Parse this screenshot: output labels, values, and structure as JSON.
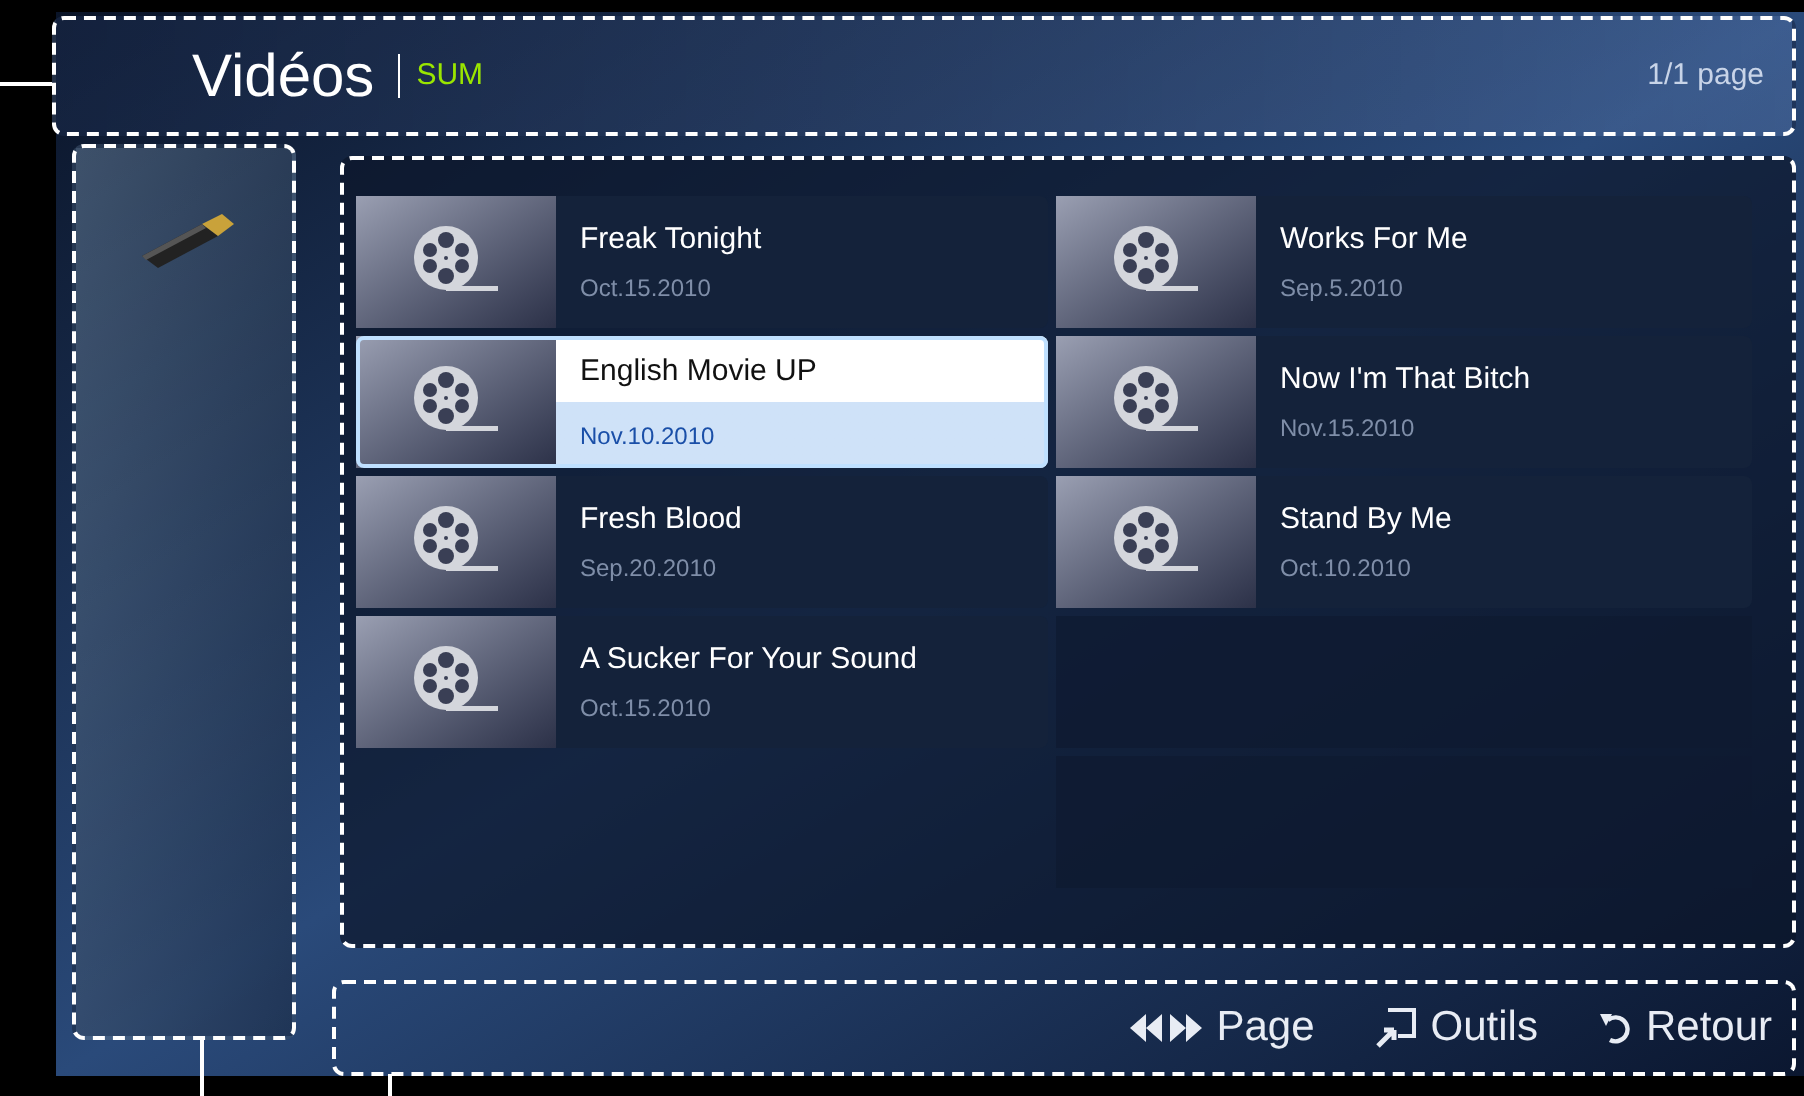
{
  "header": {
    "title": "Vidéos",
    "source": "SUM",
    "page_count": "1/1 page"
  },
  "left_column": [
    {
      "title": "Freak Tonight",
      "date": "Oct.15.2010",
      "selected": false
    },
    {
      "title": "English Movie UP",
      "date": "Nov.10.2010",
      "selected": true
    },
    {
      "title": "Fresh Blood",
      "date": "Sep.20.2010",
      "selected": false
    },
    {
      "title": "A Sucker For Your Sound",
      "date": "Oct.15.2010",
      "selected": false
    }
  ],
  "right_column": [
    {
      "title": "Works For Me",
      "date": "Sep.5.2010",
      "selected": false
    },
    {
      "title": "Now I'm That Bitch",
      "date": "Nov.15.2010",
      "selected": false
    },
    {
      "title": "Stand By Me",
      "date": "Oct.10.2010",
      "selected": false
    }
  ],
  "footer": [
    {
      "kind": "page",
      "label": "Page"
    },
    {
      "kind": "tools",
      "label": "Outils"
    },
    {
      "kind": "return",
      "label": "Retour"
    }
  ]
}
